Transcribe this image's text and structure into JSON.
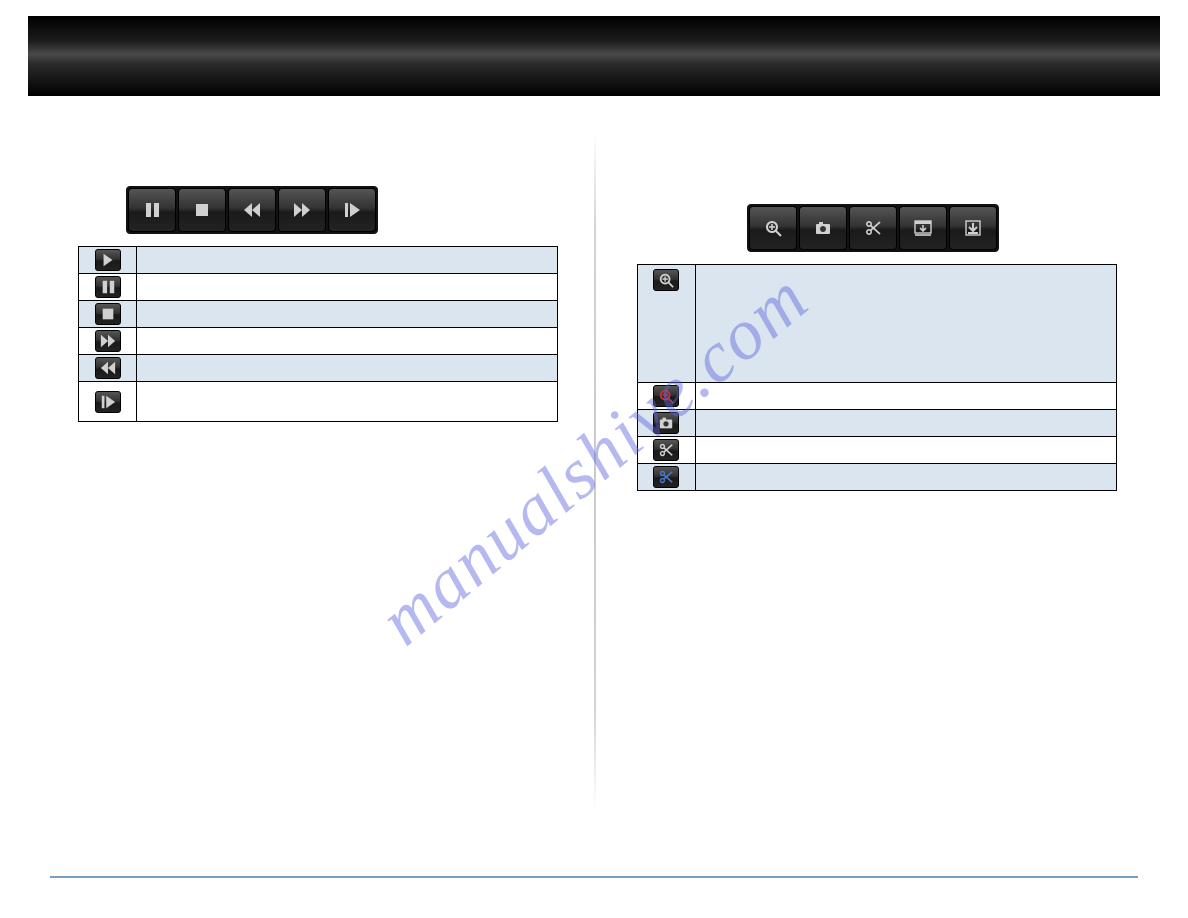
{
  "watermark_text": "manualshive.com",
  "left": {
    "toolbar_icons": [
      "pause-icon",
      "stop-icon",
      "rewind-icon",
      "fastforward-icon",
      "step-icon"
    ],
    "table": [
      {
        "icon": "play-icon",
        "desc": ""
      },
      {
        "icon": "pause-icon",
        "desc": ""
      },
      {
        "icon": "stop-icon",
        "desc": ""
      },
      {
        "icon": "fastforward-icon",
        "desc": ""
      },
      {
        "icon": "rewind-icon",
        "desc": ""
      },
      {
        "icon": "step-icon",
        "desc": ""
      }
    ]
  },
  "right": {
    "toolbar_icons": [
      "zoom-in-icon",
      "camera-icon",
      "scissors-icon",
      "video-download-icon",
      "download-icon"
    ],
    "table": [
      {
        "icon": "zoom-in-icon",
        "desc": ""
      },
      {
        "icon": "zoom-in-red-icon",
        "desc": ""
      },
      {
        "icon": "camera-icon",
        "desc": ""
      },
      {
        "icon": "scissors-icon",
        "desc": ""
      },
      {
        "icon": "scissors-blue-icon",
        "desc": ""
      }
    ]
  }
}
